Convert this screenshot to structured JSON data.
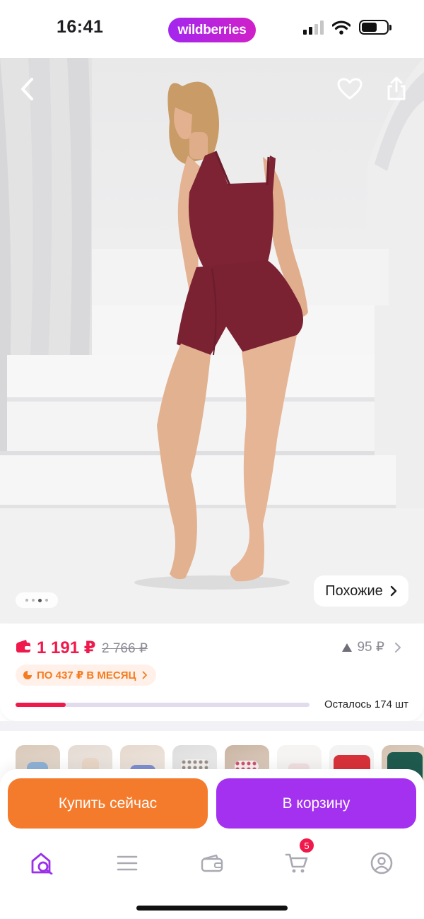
{
  "status_bar": {
    "time": "16:41",
    "brand": "wildberries",
    "icons": [
      "signal-icon",
      "wifi-icon",
      "battery-icon"
    ]
  },
  "photo": {
    "carousel_dots": 4,
    "carousel_active_index": 2,
    "similar_label": "Похожие",
    "icons": [
      "back-chevron-icon",
      "heart-icon",
      "share-icon",
      "chevron-right-icon"
    ]
  },
  "product": {
    "price": "1 191 ₽",
    "old_price": "2 766 ₽",
    "points": "95 ₽",
    "installment": "ПО 437 ₽ В МЕСЯЦ",
    "stock_text": "Осталось 174 шт",
    "stock_fraction": 0.17
  },
  "thumbnails": {
    "count": 8
  },
  "actions": {
    "buy_now_label": "Купить сейчас",
    "add_to_cart_label": "В корзину"
  },
  "tabbar": {
    "items": [
      "home-search-icon",
      "catalog-menu-icon",
      "wallet-icon",
      "cart-icon",
      "profile-icon"
    ],
    "cart_badge": "5"
  },
  "colors": {
    "brand_gradient_start": "#a326ee",
    "brand_gradient_end": "#d020c9",
    "price_red": "#f0194b",
    "buy_now_orange": "#f57b2c",
    "cart_purple": "#a431ef",
    "installment_orange": "#f57b1e"
  }
}
